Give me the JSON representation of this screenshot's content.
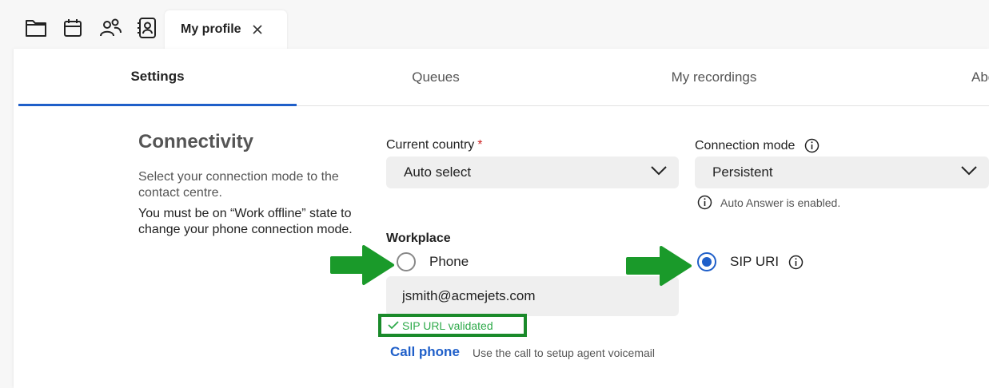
{
  "topbar": {
    "icons": [
      "folder-icon",
      "calendar-icon",
      "people-icon",
      "contact-book-icon"
    ],
    "tab": {
      "label": "My profile",
      "close_icon": "close-icon"
    }
  },
  "subtabs": {
    "settings": "Settings",
    "queues": "Queues",
    "recordings": "My recordings",
    "about": "About"
  },
  "connectivity": {
    "title": "Connectivity",
    "description": "Select your connection mode to the contact centre.",
    "note": "You must be on “Work offline” state to change your phone connection mode."
  },
  "country": {
    "label": "Current country",
    "required_mark": "*",
    "value": "Auto select"
  },
  "connection_mode": {
    "label": "Connection mode",
    "value": "Persistent",
    "info": "Auto Answer is enabled."
  },
  "workplace": {
    "label": "Workplace",
    "options": [
      {
        "label": "Phone",
        "checked": false
      },
      {
        "label": "SIP URI",
        "checked": true
      }
    ],
    "input_value": "jsmith@acmejets.com",
    "validation": "SIP URL validated",
    "call_link": "Call phone",
    "call_hint": "Use the call to setup agent voicemail"
  },
  "colors": {
    "accent": "#1f5fc9",
    "arrow_green": "#1a9a2a",
    "valid_green": "#2eaa4a"
  }
}
